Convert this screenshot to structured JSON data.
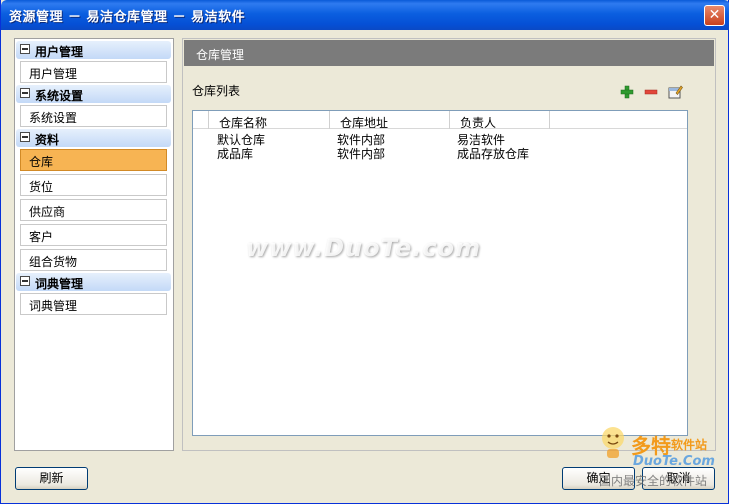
{
  "window": {
    "title": "资源管理 － 易洁仓库管理 － 易洁软件",
    "close_glyph": "✕"
  },
  "nav": {
    "groups": [
      {
        "label": "用户管理",
        "items": [
          {
            "label": "用户管理"
          }
        ]
      },
      {
        "label": "系统设置",
        "items": [
          {
            "label": "系统设置"
          }
        ]
      },
      {
        "label": "资料",
        "items": [
          {
            "label": "仓库",
            "selected": true
          },
          {
            "label": "货位"
          },
          {
            "label": "供应商"
          },
          {
            "label": "客户"
          },
          {
            "label": "组合货物"
          }
        ]
      },
      {
        "label": "词典管理",
        "items": [
          {
            "label": "词典管理"
          }
        ]
      }
    ]
  },
  "panel": {
    "header": "仓库管理",
    "list_title": "仓库列表",
    "toolbar": {
      "add_icon": "plus-icon",
      "remove_icon": "minus-icon",
      "edit_icon": "edit-icon"
    },
    "grid": {
      "columns": [
        "仓库名称",
        "仓库地址",
        "负责人"
      ],
      "rows": [
        [
          "默认仓库",
          "软件内部",
          "易洁软件"
        ],
        [
          "成品库",
          "软件内部",
          "成品存放仓库"
        ]
      ]
    }
  },
  "watermark": "www.DuoTe.com",
  "buttons": {
    "refresh": "刷新",
    "ok": "确定",
    "cancel": "取消"
  },
  "corner_logo": {
    "name": "多特",
    "suffix": "软件站",
    "brand": "DuoTe.Com",
    "tagline": "国内最安全的软件站"
  },
  "colors": {
    "titlebar": "#0a5ad8",
    "selected_item": "#f7b453",
    "panel_header": "#7b7b7b",
    "group_header": "#c3d9f7"
  }
}
